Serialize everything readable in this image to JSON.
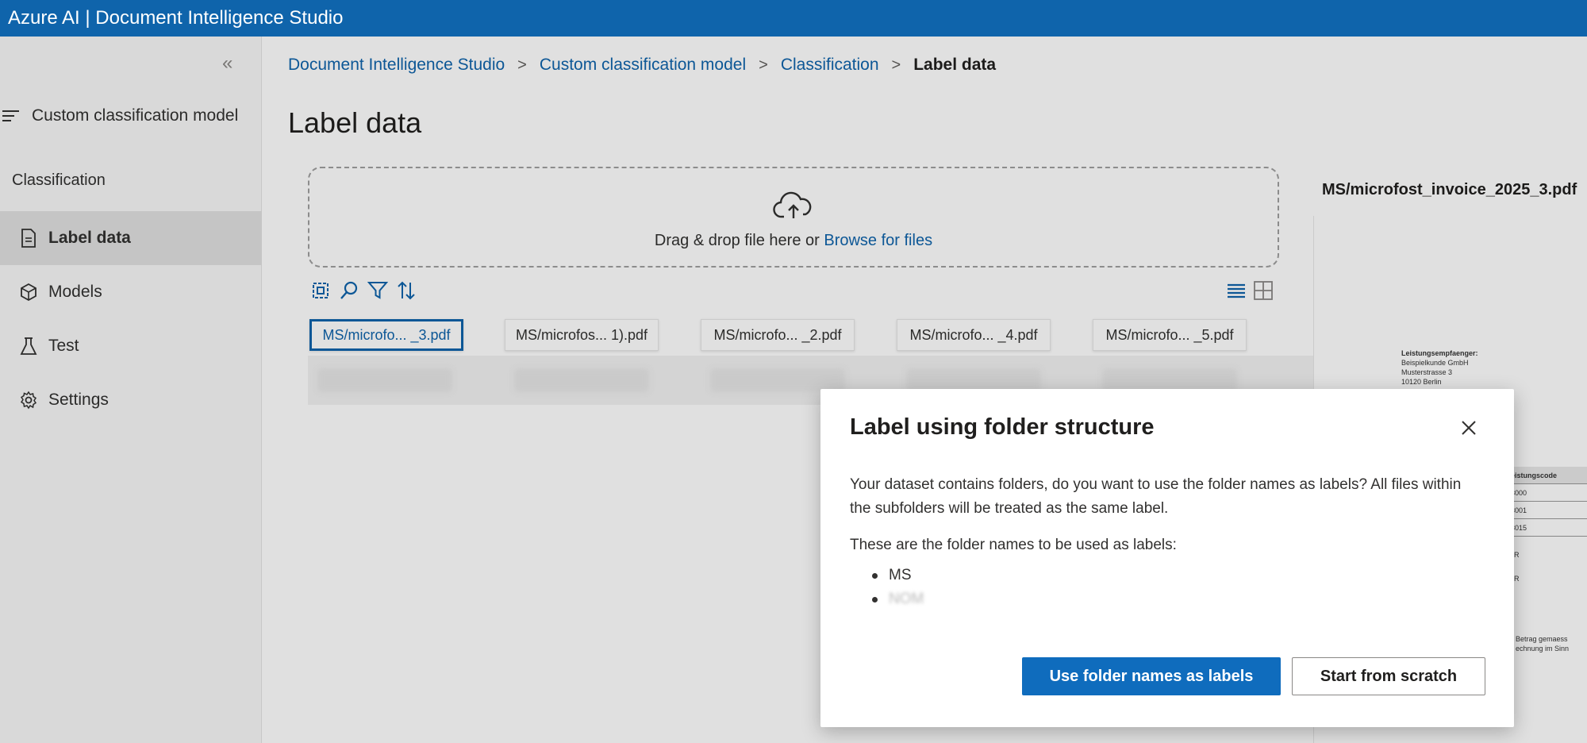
{
  "app": {
    "title": "Azure AI | Document Intelligence Studio"
  },
  "sidebar": {
    "collapse_icon": "double-chevron-left-icon",
    "model_link": "Custom classification model",
    "section": "Classification",
    "items": [
      {
        "label": "Label data",
        "icon": "document-icon",
        "active": true
      },
      {
        "label": "Models",
        "icon": "cube-icon",
        "active": false
      },
      {
        "label": "Test",
        "icon": "flask-icon",
        "active": false
      },
      {
        "label": "Settings",
        "icon": "gear-icon",
        "active": false
      }
    ]
  },
  "breadcrumb": {
    "items": [
      "Document Intelligence Studio",
      "Custom classification model",
      "Classification"
    ],
    "current": "Label data"
  },
  "page": {
    "title": "Label data"
  },
  "dropzone": {
    "text": "Drag & drop file here or ",
    "link": "Browse for files"
  },
  "files": [
    {
      "label": "MS/microfo... _3.pdf",
      "selected": true
    },
    {
      "label": "MS/microfos... 1).pdf",
      "selected": false
    },
    {
      "label": "MS/microfo... _2.pdf",
      "selected": false
    },
    {
      "label": "MS/microfo... _4.pdf",
      "selected": false
    },
    {
      "label": "MS/microfo... _5.pdf",
      "selected": false
    }
  ],
  "preview": {
    "title": "MS/microfost_invoice_2025_3.pdf",
    "lines": {
      "recipient_heading": "Leistungsempfaenger:",
      "recipient_1": "Beispielkunde GmbH",
      "recipient_2": "Musterstrasse 3",
      "recipient_3": "10120 Berlin",
      "table_header": "eistungscode",
      "row_1": "3000",
      "row_2": "3001",
      "row_3": "3015",
      "mark_1": "R",
      "mark_2": "R",
      "footer_1": "Betrag gemaess",
      "footer_2": "echnung im Sinn"
    }
  },
  "dialog": {
    "title": "Label using folder structure",
    "body": "Your dataset contains folders, do you want to use the folder names as labels? All files within the subfolders will be treated as the same label.",
    "list_intro": "These are the folder names to be used as labels:",
    "folders": [
      "MS",
      "NOM"
    ],
    "primary_button": "Use folder names as labels",
    "secondary_button": "Start from scratch",
    "close_icon": "close-icon"
  },
  "colors": {
    "brand": "#0f64ab",
    "primary_button": "#0f6cbd",
    "active_nav": "#e1e1e1"
  }
}
